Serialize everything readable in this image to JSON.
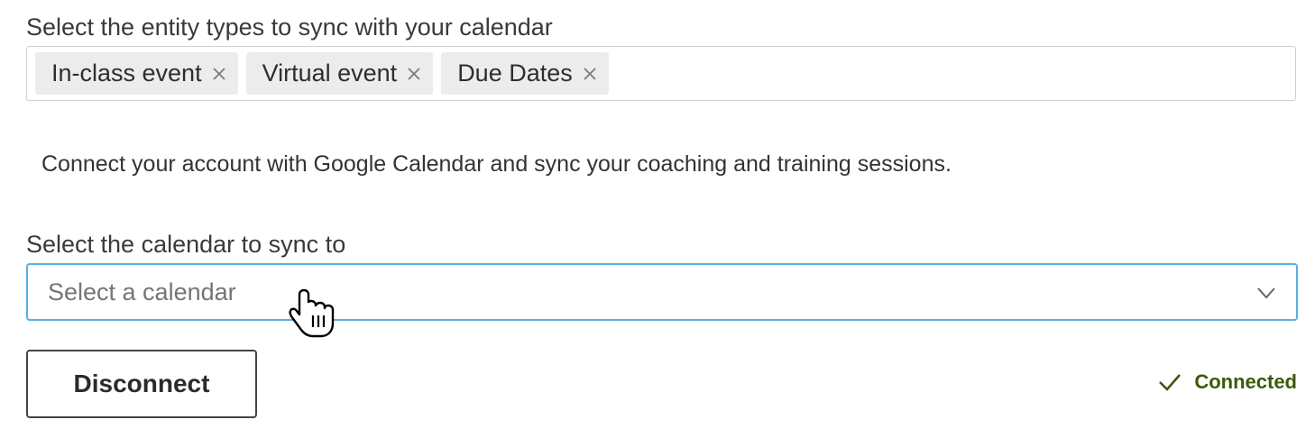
{
  "entity_section": {
    "label": "Select the entity types to sync with your calendar",
    "tags": [
      {
        "label": "In-class event",
        "remove_icon": "close-icon"
      },
      {
        "label": "Virtual event",
        "remove_icon": "close-icon"
      },
      {
        "label": "Due Dates",
        "remove_icon": "close-icon"
      }
    ]
  },
  "connect_text": "Connect your account with Google Calendar and sync your coaching and training sessions.",
  "calendar_section": {
    "label": "Select the calendar to sync to",
    "placeholder": "Select a calendar",
    "dropdown_icon": "chevron-down-icon"
  },
  "disconnect_button": {
    "label": "Disconnect"
  },
  "status": {
    "label": "Connected",
    "icon": "check-icon",
    "color": "#3c5a0a"
  },
  "colors": {
    "focus_border": "#5aaee6",
    "tag_background": "#ececec"
  }
}
